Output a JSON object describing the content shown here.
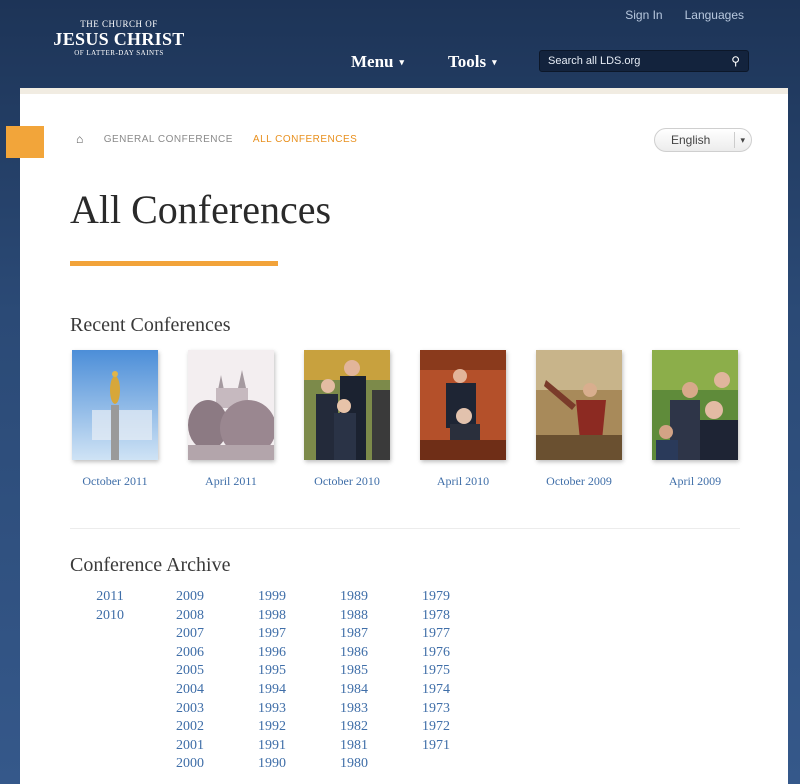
{
  "header": {
    "logo": {
      "line1": "THE CHURCH OF",
      "line2": "JESUS CHRIST",
      "line3": "OF LATTER-DAY SAINTS"
    },
    "sign_in": "Sign In",
    "languages": "Languages",
    "nav": [
      {
        "label": "Menu"
      },
      {
        "label": "Tools"
      }
    ],
    "search": {
      "value": "Search all LDS.org"
    }
  },
  "breadcrumb": {
    "items": [
      "GENERAL CONFERENCE",
      "ALL CONFERENCES"
    ]
  },
  "language_select": {
    "selected": "English"
  },
  "page_title": "All Conferences",
  "recent": {
    "heading": "Recent Conferences",
    "items": [
      {
        "label": "October 2011"
      },
      {
        "label": "April 2011"
      },
      {
        "label": "October 2010"
      },
      {
        "label": "April 2010"
      },
      {
        "label": "October 2009"
      },
      {
        "label": "April 2009"
      }
    ]
  },
  "archive": {
    "heading": "Conference Archive",
    "columns": [
      [
        "2011",
        "2010"
      ],
      [
        "2009",
        "2008",
        "2007",
        "2006",
        "2005",
        "2004",
        "2003",
        "2002",
        "2001",
        "2000"
      ],
      [
        "1999",
        "1998",
        "1997",
        "1996",
        "1995",
        "1994",
        "1993",
        "1992",
        "1991",
        "1990"
      ],
      [
        "1989",
        "1988",
        "1987",
        "1986",
        "1985",
        "1984",
        "1983",
        "1982",
        "1981",
        "1980"
      ],
      [
        "1979",
        "1978",
        "1977",
        "1976",
        "1975",
        "1974",
        "1973",
        "1972",
        "1971"
      ]
    ]
  }
}
